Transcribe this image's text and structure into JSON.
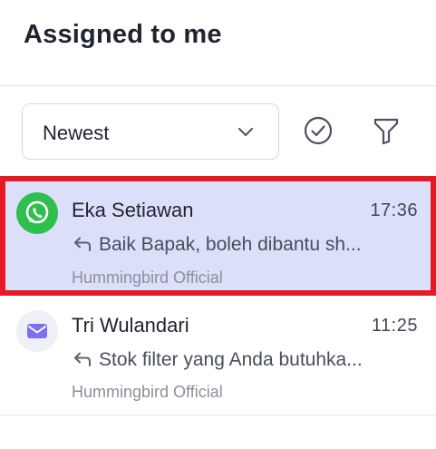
{
  "header": {
    "title": "Assigned to me"
  },
  "filters": {
    "sort_selected": "Newest",
    "icons": [
      "chevron-down-icon",
      "check-circle-icon",
      "filter-icon"
    ]
  },
  "conversations": [
    {
      "name": "Eka Setiawan",
      "time": "17:36",
      "preview": "Baik Bapak, boleh dibantu sh...",
      "inbox": "Hummingbird Official",
      "channel_icon": "whatsapp-icon",
      "channel_color": "#25d366",
      "selected": true
    },
    {
      "name": "Tri Wulandari",
      "time": "11:25",
      "preview": "Stok filter yang Anda butuhka...",
      "inbox": "Hummingbird Official",
      "channel_icon": "email-icon",
      "channel_color": "#7c6ff0",
      "selected": false
    }
  ],
  "colors": {
    "selected_bg": "#dcdffa",
    "highlight_border": "#e51a24",
    "text_primary": "#1f2430",
    "text_muted": "#8a909b"
  }
}
